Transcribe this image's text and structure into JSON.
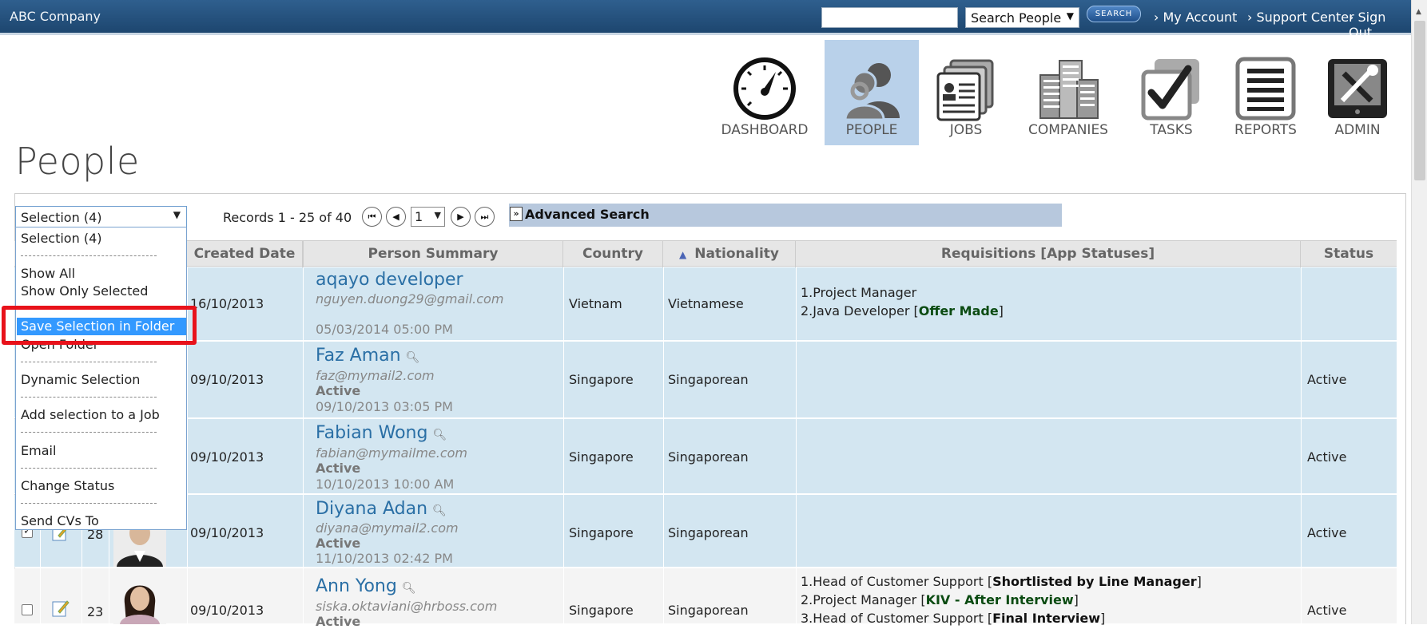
{
  "topbar": {
    "brand": "ABC Company",
    "search_value": "",
    "search_scope": "Search People",
    "search_button": "SEARCH",
    "links": [
      "› My Account",
      "› Support Center",
      "› Sign Out"
    ]
  },
  "nav": [
    {
      "label": "DASHBOARD",
      "icon": "dashboard-icon",
      "active": false
    },
    {
      "label": "PEOPLE",
      "icon": "people-icon",
      "active": true
    },
    {
      "label": "JOBS",
      "icon": "jobs-icon",
      "active": false
    },
    {
      "label": "COMPANIES",
      "icon": "companies-icon",
      "active": false
    },
    {
      "label": "TASKS",
      "icon": "tasks-icon",
      "active": false
    },
    {
      "label": "REPORTS",
      "icon": "reports-icon",
      "active": false
    },
    {
      "label": "ADMIN",
      "icon": "admin-icon",
      "active": false
    }
  ],
  "page": {
    "title": "People",
    "selection_value": "Selection (4)",
    "records": "Records 1 - 25 of 40",
    "page_number": "1",
    "advanced_search": "Advanced Search"
  },
  "dropdown": {
    "items": [
      "Selection (4)",
      "Show All",
      "Show Only Selected",
      "Save Selection in Folder",
      "Open Folder",
      "Dynamic Selection",
      "Add selection to a Job",
      "Email",
      "Change Status",
      "Send CVs To"
    ],
    "highlighted": "Save Selection in Folder"
  },
  "table": {
    "headers": [
      "Created Date",
      "Person Summary",
      "Country",
      "Nationality",
      "Requisitions [App Statuses]",
      "Status"
    ],
    "sort_indicator": "▲",
    "rows": [
      {
        "id": "",
        "created": "16/10/2013",
        "name": "aqayo developer",
        "email": "nguyen.duong29@gmail.com",
        "person_status": "",
        "person_date": "05/03/2014 05:00 PM",
        "country": "Vietnam",
        "nationality": "Vietnamese",
        "req": [
          {
            "text": "1.Project Manager",
            "status": ""
          },
          {
            "text": "2.Java Developer [",
            "status": "Offer Made",
            "close": "]"
          }
        ],
        "status": "",
        "checked": true,
        "selected": true
      },
      {
        "id": "",
        "created": "09/10/2013",
        "name": "Faz Aman",
        "email": "faz@mymail2.com",
        "person_status": "Active",
        "person_date": "09/10/2013 03:05 PM",
        "country": "Singapore",
        "nationality": "Singaporean",
        "req": [],
        "status": "Active",
        "checked": true,
        "selected": true
      },
      {
        "id": "",
        "created": "09/10/2013",
        "name": "Fabian Wong",
        "email": "fabian@mymailme.com",
        "person_status": "Active",
        "person_date": "10/10/2013 10:00 AM",
        "country": "Singapore",
        "nationality": "Singaporean",
        "req": [],
        "status": "Active",
        "checked": true,
        "selected": true
      },
      {
        "id": "28",
        "created": "09/10/2013",
        "name": "Diyana Adan",
        "email": "diyana@mymail2.com",
        "person_status": "Active",
        "person_date": "11/10/2013 02:42 PM",
        "country": "Singapore",
        "nationality": "Singaporean",
        "req": [],
        "status": "Active",
        "checked": true,
        "selected": true
      },
      {
        "id": "23",
        "created": "09/10/2013",
        "name": "Ann Yong",
        "email": "siska.oktaviani@hrboss.com",
        "person_status": "Active",
        "person_date": "",
        "country": "Singapore",
        "nationality": "Singaporean",
        "req": [
          {
            "text": "1.Head of Customer Support [",
            "status": "Shortlisted by Line Manager",
            "close": "]",
            "black": true
          },
          {
            "text": "2.Project Manager [",
            "status": "KIV - After Interview",
            "close": "]"
          },
          {
            "text": "3.Head of Customer Support [",
            "status": "Final Interview",
            "close": "]",
            "black": true
          }
        ],
        "status": "Active",
        "checked": false,
        "selected": false
      }
    ]
  },
  "colors": {
    "topbar": "#1d466f",
    "nav_active": "#b9d1ea",
    "row_selected": "#d3e6f1",
    "link_blue": "#2a6fa5",
    "highlight": "#3399ff",
    "callout_red": "#e8121b"
  }
}
